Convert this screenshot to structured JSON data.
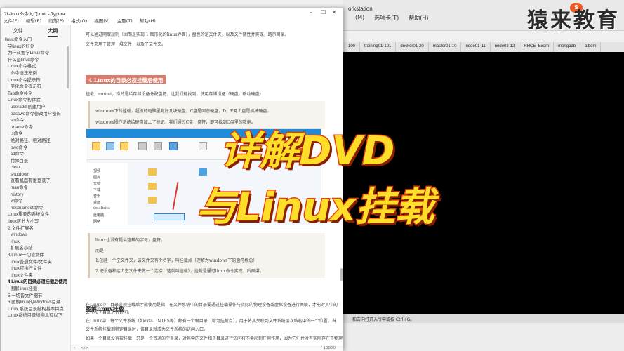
{
  "typora": {
    "title": "01-linux命令入门.mdr - Typora",
    "menu": [
      "文件(F)",
      "编辑(E)",
      "段落(P)",
      "格式(O)",
      "视图(V)",
      "主题(T)",
      "帮助(H)"
    ]
  },
  "sidebar": {
    "tabs": [
      "文件",
      "大纲"
    ],
    "outline": [
      {
        "label": "linux命令入门",
        "level": 0
      },
      {
        "label": "学linux的好处",
        "level": 1
      },
      {
        "label": "为什么要学Linux命令",
        "level": 1
      },
      {
        "label": "什么是linux命令",
        "level": 1
      },
      {
        "label": "Linux命令格式",
        "level": 1
      },
      {
        "label": "命令语法案例",
        "level": 2
      },
      {
        "label": "Linux命令提示符",
        "level": 1
      },
      {
        "label": "美化命令提示符",
        "level": 2
      },
      {
        "label": "Tab命令补全",
        "level": 1
      },
      {
        "label": "Linux命令初体验",
        "level": 1
      },
      {
        "label": "useradd 创建用户",
        "level": 2
      },
      {
        "label": "passwd命令修改用户密码",
        "level": 2
      },
      {
        "label": "su命令",
        "level": 2
      },
      {
        "label": "uname命令",
        "level": 2
      },
      {
        "label": "ls命令",
        "level": 2
      },
      {
        "label": "绝对路径、相对路径",
        "level": 2
      },
      {
        "label": "pwd命令",
        "level": 2
      },
      {
        "label": "cd命令",
        "level": 2
      },
      {
        "label": "特殊目录",
        "level": 2
      },
      {
        "label": "clear",
        "level": 2
      },
      {
        "label": "shutdown",
        "level": 2
      },
      {
        "label": "查看机器有谁登录了",
        "level": 2
      },
      {
        "label": "man命令",
        "level": 2
      },
      {
        "label": "history",
        "level": 2
      },
      {
        "label": "w命令",
        "level": 2
      },
      {
        "label": "hostnamectl命令",
        "level": 2
      },
      {
        "label": "Linux重要的系统文件",
        "level": 1
      },
      {
        "label": "linux区分大小写",
        "level": 1
      },
      {
        "label": "2.文件扩展名",
        "level": 1
      },
      {
        "label": "windows",
        "level": 2
      },
      {
        "label": "linux",
        "level": 2
      },
      {
        "label": "扩展名小结",
        "level": 2
      },
      {
        "label": "3.Linux一切皆文件",
        "level": 1
      },
      {
        "label": "linux普通文件/文件夹",
        "level": 2
      },
      {
        "label": "linux可执行文件",
        "level": 2
      },
      {
        "label": "linux文件夹",
        "level": 2
      },
      {
        "label": "4.Linux的目录必须挂载后使用",
        "level": 1,
        "selected": true
      },
      {
        "label": "图解linux挂载",
        "level": 2
      },
      {
        "label": "5.一切皆文件细节",
        "level": 1
      },
      {
        "label": "6.图解linux的Windows目录",
        "level": 1
      },
      {
        "label": "Linux 系统目录结构基本特点",
        "level": 1
      },
      {
        "label": "Linux系统目录结构具有以下",
        "level": 1
      }
    ]
  },
  "doc": {
    "top_line1": "可以通过网眼规则（因而是实现 1 图形化的linux界面），盘也的是文件夹，以及文件随性并实现，路示目录。",
    "top_line2": "文件夹用于管理一堆文件，以及子文件夹。",
    "h4": "4.Linux的目录必须挂载后使用",
    "intro": "挂载，mount，指的是给存储设备分配盘符，让我们能找到，使用存储设备（硬盘，移动硬盘）",
    "quote1_line1": "windows下的挂载，超级的电脑里有好几块硬盘，C盘是固态硬盘，D，E两个盘是机械硬盘。",
    "quote1_line2": "windows操作系统给硬盘加上了标记，我们通过C盘，盘符，即可找到C盘里的数据。",
    "shot_nav": [
      "视频",
      "图片",
      "文档",
      "下载",
      "音乐",
      "桌面",
      "OneDrive",
      "此电脑",
      "网络"
    ],
    "quote2_line1": "linux也没有提供这样的字母，盘符。",
    "quote2_line2": "而是",
    "quote2_line3": "1.创建一个空文件夹，该文件夹有个名字，叫挂载点（理解为windows下的盘符概念）",
    "quote2_line4": "2.把设备和这个空文件夹做一个连接（这就叫挂载），挂载是通过linux命令实现，后面讲。",
    "heading_mount": "图解linux挂载",
    "para1_line1": "在Linux中，目录必须挂载后才能使用是指，在文件系统中的目录要通过挂载操作与实际的物理设备或虚拟设备进行关联，才能对其中的",
    "para1_line2": "文件和子目录进行访问。",
    "para2_line1": "在Linux中，每个文件系统（如ext4、NTFS等）都有一个根目录（称为挂载点），用于将其关联到文件系统层次结构中的一个位置。当",
    "para2_line2": "文件系统挂载到特定目录时，该目录就成为文件系统的访问入口。",
    "para3_line1": "如果一个目录没有被挂载，只是一个普通的空目录，对其中的文件和子目录进行访问将不会起到任何作用，因为它们并没有实际存在于物理"
  },
  "statusbar": {
    "words": "/ 13850"
  },
  "bgapp": {
    "title": "orkstation",
    "menu": [
      "(M)",
      "选项卡(T)",
      "帮助(H)"
    ],
    "tabs": [
      "-100",
      "training01-101",
      "docker01-20",
      "master01-10",
      "node01-11",
      "node02-12",
      "RHCE_Exam",
      "mongodb",
      "alberti"
    ],
    "status_hint": "和击向打开入所中或按 Ctrl+G。"
  },
  "logo": {
    "text": "猿来教育",
    "badge": "S"
  },
  "overlay": {
    "line1": "详解DVD",
    "line2": "与Linux挂载"
  }
}
